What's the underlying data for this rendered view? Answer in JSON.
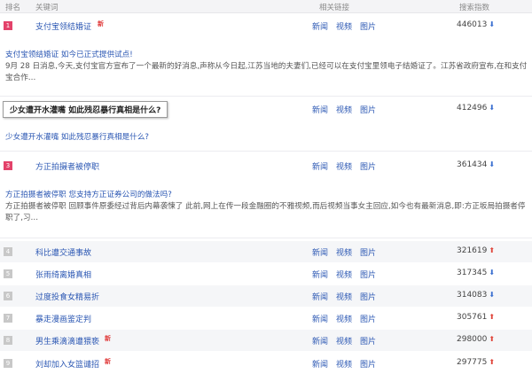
{
  "columns": {
    "rank": "排名",
    "keyword": "关键词",
    "links": "相关链接",
    "count": "搜索指数"
  },
  "link_labels": [
    "新闻",
    "视频",
    "图片"
  ],
  "colors": {
    "hot_rank": "#e3426a",
    "normal_rank": "#c8c8c8",
    "link": "#2b57b3",
    "arrow_down": "#3a6fd0",
    "arrow_up": "#e0453a"
  },
  "items": [
    {
      "rank": "1",
      "keyword": "支付宝领结婚证",
      "new": "新",
      "count": "446013",
      "trend": "down",
      "detail_title": "支付宝领结婚证 如今已正式提供试点!",
      "detail_text": "9月 28 日消息,今天,支付宝官方宣布了一个最新的好消息,声称从今日起,江苏当地的夫妻们,已经可以在支付宝里领电子结婚证了。江苏省政府宣布,在和支付宝合作…"
    },
    {
      "rank": "2",
      "keyword": "少女遭开水灌嘴 如此残忍暴行真相是什么?",
      "count": "412496",
      "trend": "down",
      "detail_title": "少女遭开水灌嘴 如此残忍暴行真相是什么?"
    },
    {
      "rank": "3",
      "keyword": "方正拍摄者被停职",
      "count": "361434",
      "trend": "down",
      "detail_title": "方正拍摄者被停职 您支持方正证券公司的做法吗?",
      "detail_text": "方正拍摄者被停职 回顾事件原委经过背后内幕袭悚了 此前,网上在传一段金融圈的不雅视频,而后视频当事女主回应,如今也有最新消息,即:方正坂局拍摄者停职了,习…"
    },
    {
      "rank": "4",
      "keyword": "科比遭交通事故",
      "count": "321619",
      "trend": "up"
    },
    {
      "rank": "5",
      "keyword": "张雨绮离婚真相",
      "count": "317345",
      "trend": "down"
    },
    {
      "rank": "6",
      "keyword": "过度投食女精易折",
      "count": "314083",
      "trend": "down"
    },
    {
      "rank": "7",
      "keyword": "暴走漫画鉴定判",
      "count": "305761",
      "trend": "up"
    },
    {
      "rank": "8",
      "keyword": "男生乘滴滴遭猥亵",
      "new": "新",
      "count": "298000",
      "trend": "up"
    },
    {
      "rank": "9",
      "keyword": "刘却加入女篮谴招",
      "new": "新",
      "count": "297775",
      "trend": "up"
    }
  ]
}
